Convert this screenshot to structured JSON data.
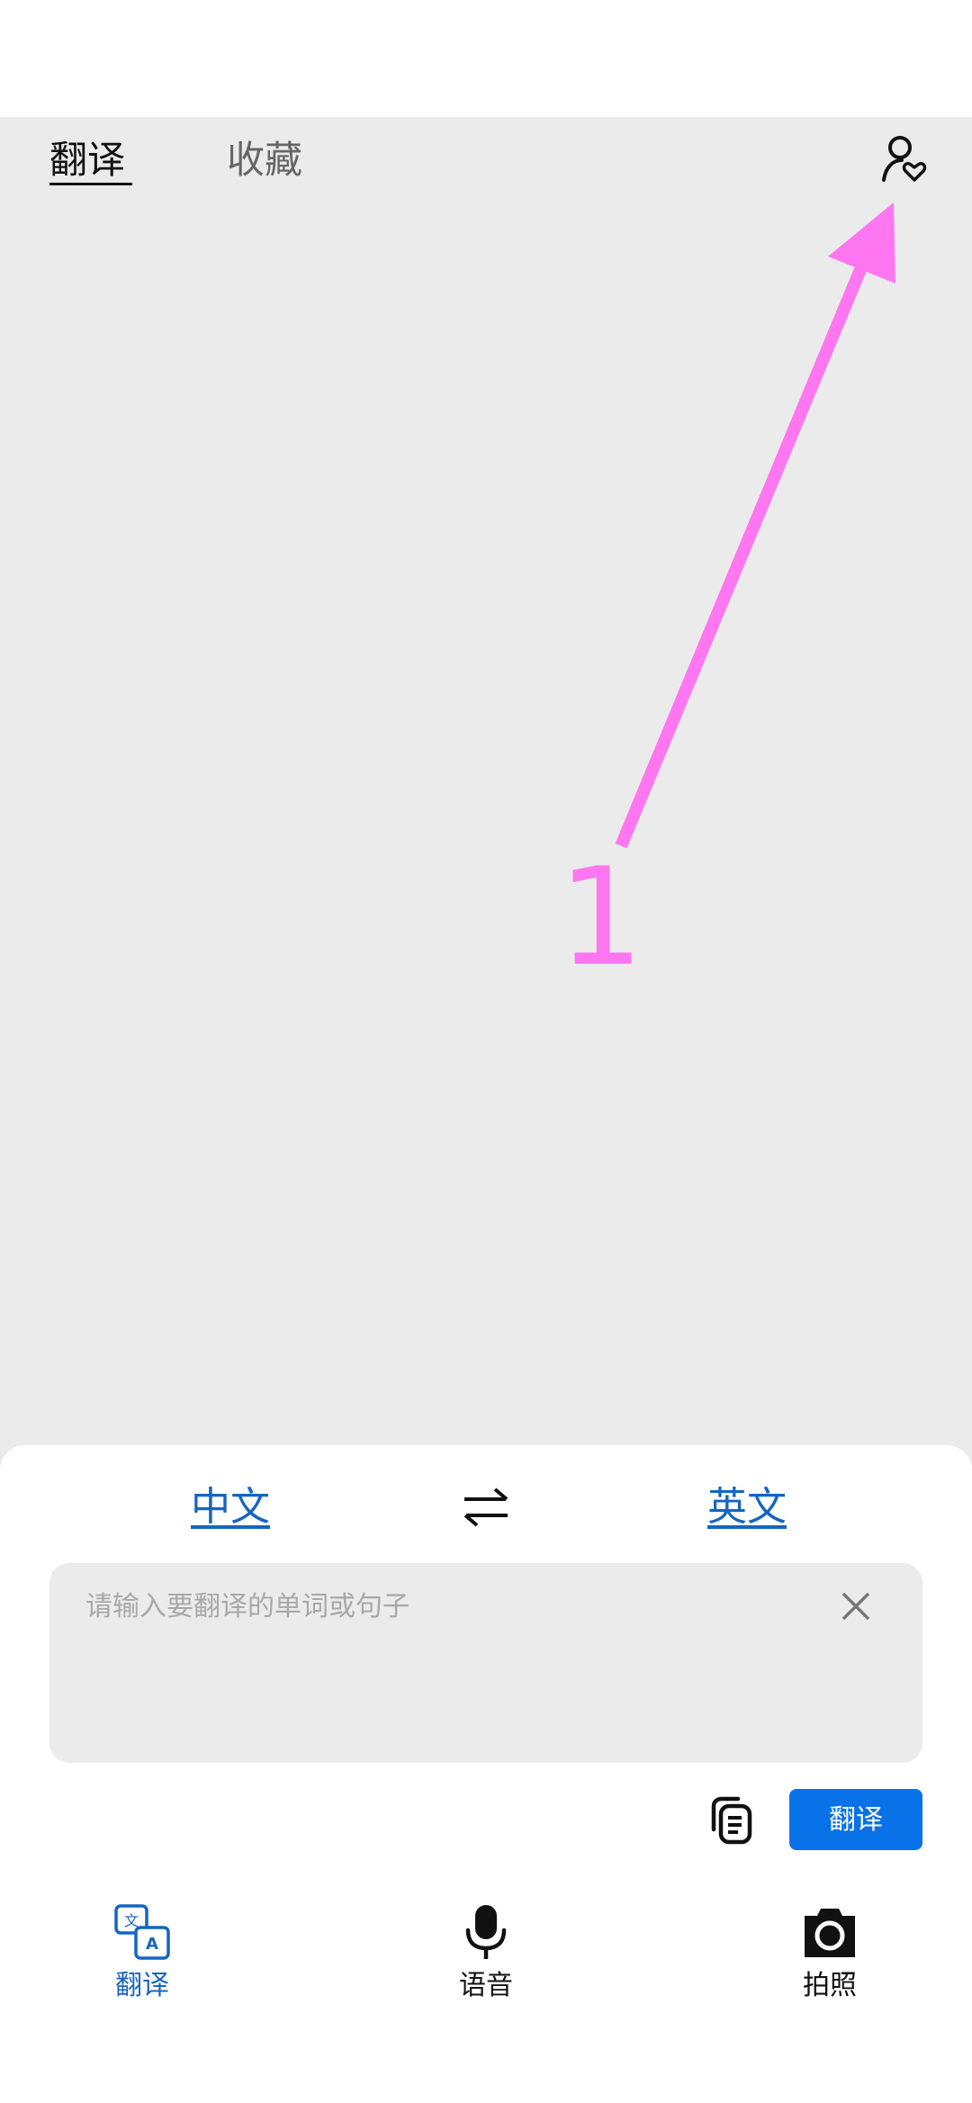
{
  "header": {
    "tabs": [
      {
        "label": "翻译",
        "active": true
      },
      {
        "label": "收藏",
        "active": false
      }
    ],
    "profile_icon": "person-heart-icon"
  },
  "annotation": {
    "number": "1",
    "color": "#ff77f0"
  },
  "language_bar": {
    "source_label": "中文",
    "target_label": "英文",
    "swap_icon": "swap-arrows-icon"
  },
  "input": {
    "value": "",
    "placeholder": "请输入要翻译的单词或句子",
    "clear_icon": "close-icon"
  },
  "actions": {
    "copy_icon": "clipboard-icon",
    "translate_label": "翻译"
  },
  "bottom_nav": {
    "items": [
      {
        "label": "翻译",
        "icon": "translate-icon",
        "active": true
      },
      {
        "label": "语音",
        "icon": "microphone-icon",
        "active": false
      },
      {
        "label": "拍照",
        "icon": "camera-icon",
        "active": false
      }
    ]
  },
  "colors": {
    "accent": "#0a72e8",
    "link": "#1565c0",
    "background": "#ebebeb"
  }
}
